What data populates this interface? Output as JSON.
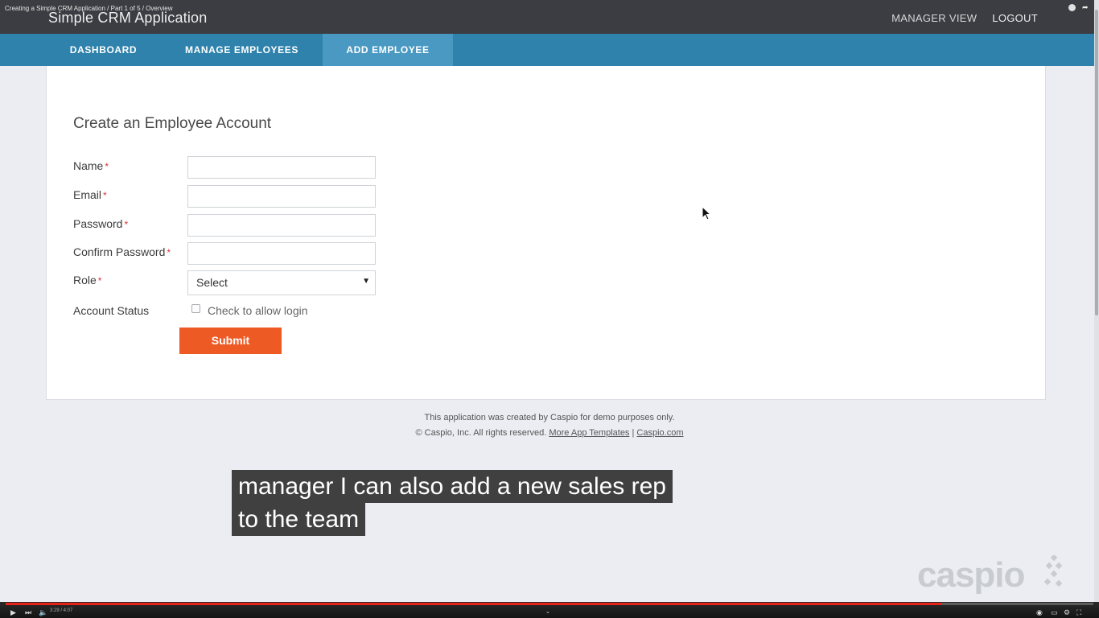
{
  "video_title": "Creating a Simple CRM Application / Part 1 of 5 / Overview",
  "header": {
    "app_title": "Simple CRM Application",
    "links": {
      "manager_view": "MANAGER VIEW",
      "logout": "LOGOUT"
    }
  },
  "nav": {
    "dashboard": "DASHBOARD",
    "manage_employees": "MANAGE EMPLOYEES",
    "add_employee": "ADD EMPLOYEE",
    "active": "ADD EMPLOYEE"
  },
  "form": {
    "title": "Create an Employee Account",
    "required_mark": "*",
    "fields": {
      "name_label": "Name",
      "email_label": "Email",
      "password_label": "Password",
      "confirm_password_label": "Confirm Password",
      "role_label": "Role",
      "account_status_label": "Account Status"
    },
    "values": {
      "name": "",
      "email": "",
      "password": "",
      "confirm_password": ""
    },
    "role_selected": "Select",
    "account_status_checkbox_label": "Check to allow login",
    "account_status_checked": false,
    "submit_label": "Submit"
  },
  "footer": {
    "line1": "This application was created by Caspio for demo purposes only.",
    "copyright": "© Caspio, Inc. All rights reserved.",
    "more_templates_link": "More App Templates",
    "separator": "|",
    "caspio_link": "Caspio.com"
  },
  "caption": {
    "line1": "manager I can also add a new sales rep",
    "line2": "to the team"
  },
  "watermark": "caspio",
  "player": {
    "time": "3:29 / 4:07",
    "progress_fraction": 0.86
  },
  "colors": {
    "topbar": "#3b3d42",
    "navbar": "#2e82ac",
    "nav_active": "#4a99c2",
    "submit": "#ee5a24",
    "progress": "#e62117"
  },
  "icons": [
    "clock-icon",
    "share-icon",
    "play-icon",
    "next-icon",
    "volume-icon",
    "settings-icon",
    "fullscreen-icon",
    "dropdown-arrow-icon"
  ]
}
